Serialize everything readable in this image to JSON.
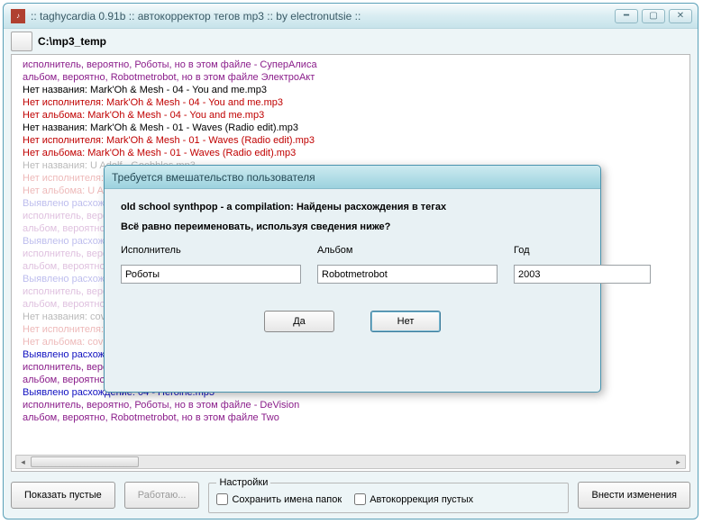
{
  "main": {
    "title": ":: taghycardia 0.91b :: автокорректор тегов mp3 :: by electronutsie ::",
    "path": "C:\\mp3_temp",
    "log": [
      {
        "cls": "c-purple",
        "dim": false,
        "text": "исполнитель, вероятно, Роботы, но в этом файле - СуперАлиса"
      },
      {
        "cls": "c-purple",
        "dim": false,
        "text": "альбом, вероятно, Robotmetrobot, но в этом файле ЭлектроАкт"
      },
      {
        "cls": "c-black",
        "dim": false,
        "text": "Нет названия: Mark'Oh & Mesh - 04 - You and me.mp3"
      },
      {
        "cls": "c-red",
        "dim": false,
        "text": "Нет исполнителя: Mark'Oh & Mesh - 04 - You and me.mp3"
      },
      {
        "cls": "c-red",
        "dim": false,
        "text": "Нет альбома: Mark'Oh & Mesh - 04 - You and me.mp3"
      },
      {
        "cls": "c-black",
        "dim": false,
        "text": "Нет названия: Mark'Oh & Mesh - 01 - Waves (Radio edit).mp3"
      },
      {
        "cls": "c-red",
        "dim": false,
        "text": "Нет исполнителя: Mark'Oh & Mesh - 01 - Waves (Radio edit).mp3"
      },
      {
        "cls": "c-red",
        "dim": false,
        "text": "Нет альбома: Mark'Oh & Mesh - 01 - Waves (Radio edit).mp3"
      },
      {
        "cls": "c-black",
        "dim": true,
        "text": "Нет названия: U Adolf - Goebbles.mp3"
      },
      {
        "cls": "c-red",
        "dim": true,
        "text": "Нет исполнителя: U Adolf - Goebbles.mp3"
      },
      {
        "cls": "c-red",
        "dim": true,
        "text": "Нет альбома: U Adolf - Goebbles.mp3"
      },
      {
        "cls": "c-navy",
        "dim": true,
        "text": "Выявлено расхождение: Роботы - 05 (Svet Dalekoi Zvezdi).mp3"
      },
      {
        "cls": "c-purple",
        "dim": true,
        "text": "исполнитель, вероятно, Роботы, но в этом файле - DeVision"
      },
      {
        "cls": "c-purple",
        "dim": true,
        "text": "альбом, вероятно, Robotmetrobot, но в этом файле unsorted"
      },
      {
        "cls": "c-navy",
        "dim": true,
        "text": "Выявлено расхождение: Роботы - 15 (Svet Dalekoi Zvezdi).mp3"
      },
      {
        "cls": "c-purple",
        "dim": true,
        "text": "исполнитель, вероятно, Роботы, но в этом файле - DeMARSH"
      },
      {
        "cls": "c-purple",
        "dim": true,
        "text": "альбом, вероятно, Robotmetrobot, но в этом файле unsorted"
      },
      {
        "cls": "c-navy",
        "dim": true,
        "text": "Выявлено расхождение: Das Ich - Destillat (VNV Nation Remix).mp3"
      },
      {
        "cls": "c-purple",
        "dim": true,
        "text": "исполнитель, вероятно, Роботы, но в этом файле - Das Ich"
      },
      {
        "cls": "c-purple",
        "dim": true,
        "text": "альбом, вероятно, Robotmetrobot, но в этом файле Laborat"
      },
      {
        "cls": "c-black",
        "dim": true,
        "text": "Нет названия: covenant - Theremin.mp3"
      },
      {
        "cls": "c-red",
        "dim": true,
        "text": "Нет исполнителя: covenant - Theremin.mp3"
      },
      {
        "cls": "c-red",
        "dim": true,
        "text": "Нет альбома: covenant - Theremin.mp3"
      },
      {
        "cls": "c-navy",
        "dim": false,
        "text": "Выявлено расхождение: belief - the 7th day.mp3"
      },
      {
        "cls": "c-purple",
        "dim": false,
        "text": "исполнитель, вероятно, Роботы, но в этом файле - Belief"
      },
      {
        "cls": "c-purple",
        "dim": false,
        "text": "альбом, вероятно, Robotmetrobot, но в этом файле No-Place"
      },
      {
        "cls": "c-navy",
        "dim": false,
        "text": "Выявлено расхождение: 04 - Heroine.mp3"
      },
      {
        "cls": "c-purple",
        "dim": false,
        "text": "исполнитель, вероятно, Роботы, но в этом файле - DeVision"
      },
      {
        "cls": "c-purple",
        "dim": false,
        "text": "альбом, вероятно, Robotmetrobot, но в этом файле Two"
      }
    ],
    "buttons": {
      "show_empty": "Показать пустые",
      "working": "Работаю...",
      "apply": "Внести изменения"
    },
    "settings": {
      "legend": "Настройки",
      "save_folders": "Сохранить имена папок",
      "autocorr_empty": "Автокоррекция пустых"
    }
  },
  "modal": {
    "title": "Требуется вмешательство пользователя",
    "msg1": "old school synthpop - a compilation: Найдены расхождения в тегах",
    "msg2": "Всё равно переименовать, используя сведения ниже?",
    "labels": {
      "artist": "Исполнитель",
      "album": "Альбом",
      "year": "Год"
    },
    "values": {
      "artist": "Роботы",
      "album": "Robotmetrobot",
      "year": "2003"
    },
    "buttons": {
      "yes": "Да",
      "no": "Нет"
    }
  }
}
